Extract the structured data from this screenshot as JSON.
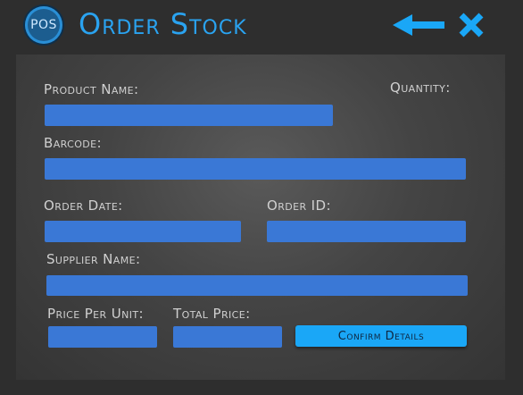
{
  "header": {
    "logo_text": "POS",
    "title": "Order Stock",
    "back_icon": "arrow-left-icon",
    "close_icon": "close-icon"
  },
  "form": {
    "product_name_label": "Product Name:",
    "quantity_label": "Quantity:",
    "barcode_label": "Barcode:",
    "order_date_label": "Order Date:",
    "order_id_label": "Order ID:",
    "supplier_name_label": "Supplier Name:",
    "price_per_unit_label": "Price Per Unit:",
    "total_price_label": "Total Price:",
    "confirm_label": "Confirm Details"
  },
  "colors": {
    "accent": "#2aa3f0",
    "field": "#3a78d6",
    "button": "#1aa7f7",
    "background": "#2e2e2e"
  }
}
